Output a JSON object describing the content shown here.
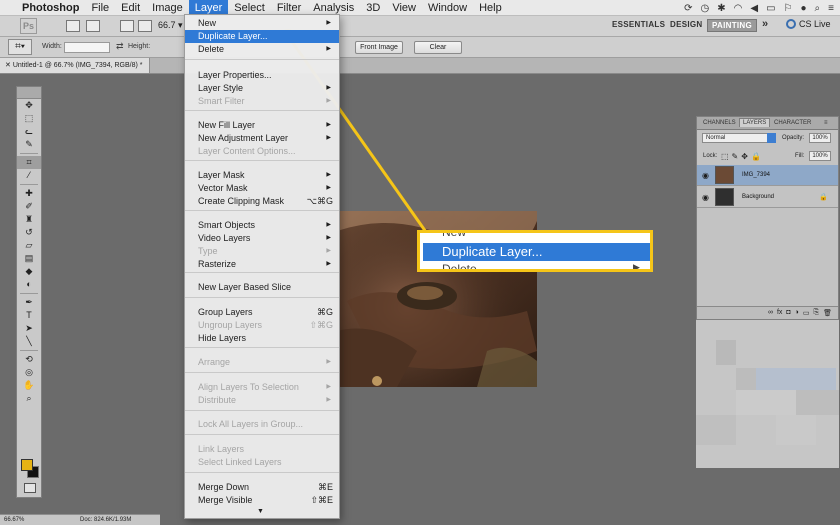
{
  "menubar": {
    "app_name": "Photoshop",
    "items": [
      "File",
      "Edit",
      "Image",
      "Layer",
      "Select",
      "Filter",
      "Analysis",
      "3D",
      "View",
      "Window",
      "Help"
    ],
    "active": "Layer"
  },
  "appbar": {
    "logo": "Ps",
    "zoom": "66.7",
    "workspaces": [
      "ESSENTIALS",
      "DESIGN",
      "PAINTING"
    ],
    "selected_workspace": "PAINTING",
    "more": "»",
    "cs_live": "CS Live"
  },
  "options": {
    "width_label": "Width:",
    "height_label": "Height:",
    "front_image": "Front Image",
    "clear": "Clear"
  },
  "document_tab": {
    "title": "Untitled-1 @ 66.7% (IMG_7394, RGB/8) *"
  },
  "layer_menu": {
    "items": [
      {
        "label": "New",
        "submenu": true
      },
      {
        "label": "Duplicate Layer...",
        "highlighted": true
      },
      {
        "label": "Delete",
        "submenu": true
      },
      {
        "label": "Layer Properties..."
      },
      {
        "label": "Layer Style",
        "submenu": true
      },
      {
        "label": "Smart Filter",
        "disabled": true,
        "submenu": true
      },
      {
        "label": "New Fill Layer",
        "submenu": true
      },
      {
        "label": "New Adjustment Layer",
        "submenu": true
      },
      {
        "label": "Layer Content Options...",
        "disabled": true
      },
      {
        "label": "Layer Mask",
        "submenu": true
      },
      {
        "label": "Vector Mask",
        "submenu": true
      },
      {
        "label": "Create Clipping Mask",
        "shortcut": "⌥⌘G"
      },
      {
        "label": "Smart Objects",
        "submenu": true
      },
      {
        "label": "Video Layers",
        "submenu": true
      },
      {
        "label": "Type",
        "disabled": true,
        "submenu": true
      },
      {
        "label": "Rasterize",
        "submenu": true
      },
      {
        "label": "New Layer Based Slice"
      },
      {
        "label": "Group Layers",
        "shortcut": "⌘G"
      },
      {
        "label": "Ungroup Layers",
        "disabled": true,
        "shortcut": "⇧⌘G"
      },
      {
        "label": "Hide Layers"
      },
      {
        "label": "Arrange",
        "disabled": true,
        "submenu": true
      },
      {
        "label": "Align Layers To Selection",
        "disabled": true,
        "submenu": true
      },
      {
        "label": "Distribute",
        "disabled": true,
        "submenu": true
      },
      {
        "label": "Lock All Layers in Group...",
        "disabled": true
      },
      {
        "label": "Link Layers",
        "disabled": true
      },
      {
        "label": "Select Linked Layers",
        "disabled": true
      },
      {
        "label": "Merge Down",
        "shortcut": "⌘E"
      },
      {
        "label": "Merge Visible",
        "shortcut": "⇧⌘E"
      }
    ],
    "more_arrow": "▼"
  },
  "callout": {
    "top_fragment": "New",
    "highlighted": "Duplicate Layer...",
    "bottom_fragment": "Delete"
  },
  "layers_panel": {
    "tabs": [
      "CHANNELS",
      "LAYERS",
      "CHARACTER"
    ],
    "active_tab": "LAYERS",
    "blend_mode": "Normal",
    "opacity_label": "Opacity:",
    "opacity": "100%",
    "lock_label": "Lock:",
    "fill_label": "Fill:",
    "fill": "100%",
    "layers": [
      {
        "name": "IMG_7394",
        "selected": true
      },
      {
        "name": "Background",
        "locked": true
      }
    ]
  },
  "status": {
    "zoom": "66.67%",
    "doc": "Doc: 824.6K/1.93M"
  },
  "colors": {
    "accent": "#2f7ad6",
    "callout": "#f5c518",
    "foreground": "#e6b315",
    "background": "#111111"
  }
}
